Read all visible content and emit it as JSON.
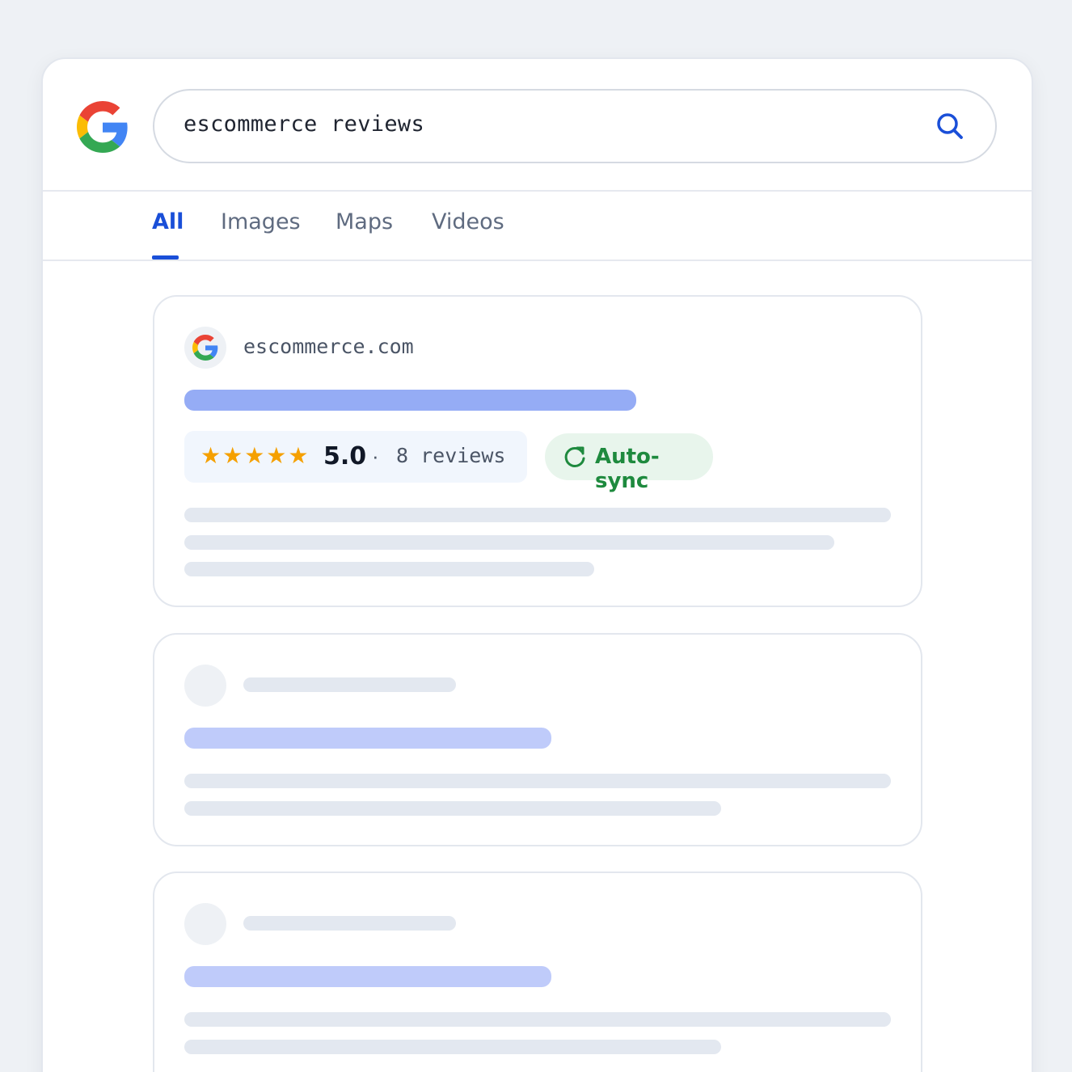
{
  "search": {
    "query": "escommerce reviews"
  },
  "tabs": [
    {
      "label": "All",
      "active": true
    },
    {
      "label": "Images",
      "active": false
    },
    {
      "label": "Maps",
      "active": false
    },
    {
      "label": "Videos",
      "active": false
    }
  ],
  "result": {
    "domain": "escommerce.com",
    "stars": "★★★★★",
    "score": "5.0",
    "separator": "·",
    "reviews": "8 reviews",
    "sync_label": "Auto-sync"
  },
  "icons": {
    "logo": "google-logo-icon",
    "search": "search-icon",
    "favicon": "google-favicon-icon",
    "sync": "refresh-icon"
  },
  "colors": {
    "accent": "#1a4fd8",
    "star": "#f5a000",
    "sync_green": "#1e8a3e",
    "title_placeholder": "#95acf5"
  }
}
